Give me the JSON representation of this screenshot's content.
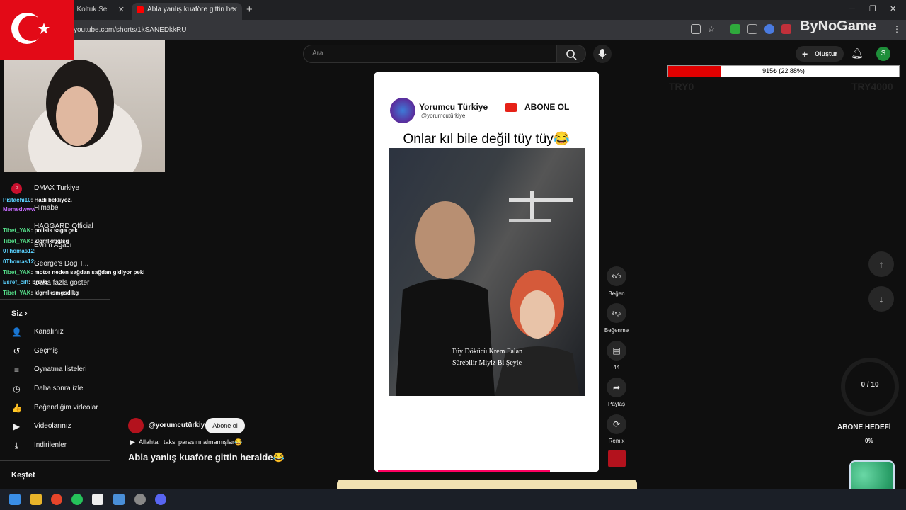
{
  "browser": {
    "tabs": [
      {
        "label": "itası | Koltuk Se",
        "active": false
      },
      {
        "label": "Abla yanlış kuaföre gittin he",
        "active": true
      }
    ],
    "url": "youtube.com/shorts/1kSANEDkkRU",
    "new_tab": "+",
    "minimize": "─",
    "restore": "❐",
    "close": "✕"
  },
  "search": {
    "placeholder": "Ara"
  },
  "header": {
    "create_label": "Oluştur",
    "avatar_letter": "S"
  },
  "sidebar": {
    "subscriptions": [
      {
        "label": "DMAX Turkiye"
      },
      {
        "label": "Himabe"
      },
      {
        "label": "HAGGARD Official"
      },
      {
        "label": "Evrim Ağacı"
      },
      {
        "label": "George's Dog T..."
      },
      {
        "label": "Daha fazla göster"
      }
    ],
    "you_header": "Siz",
    "you_items": [
      {
        "label": "Kanalınız",
        "icon": "channel-icon"
      },
      {
        "label": "Geçmiş",
        "icon": "history-icon"
      },
      {
        "label": "Oynatma listeleri",
        "icon": "playlist-icon"
      },
      {
        "label": "Daha sonra izle",
        "icon": "clock-icon"
      },
      {
        "label": "Beğendiğim videolar",
        "icon": "thumbs-up-icon"
      },
      {
        "label": "Videolarınız",
        "icon": "video-icon"
      },
      {
        "label": "İndirilenler",
        "icon": "download-icon"
      }
    ],
    "explore_header": "Keşfet"
  },
  "chat": [
    {
      "user": "Pistachi10",
      "msg": ": Hadi bekliyoz."
    },
    {
      "user": "Memedwww",
      "msg": ""
    },
    {
      "user": "Tibet_YAK",
      "msg": ": polisis saga çek"
    },
    {
      "user": "Tibet_YAK",
      "msg": ": klgmlkmglsg"
    },
    {
      "user": "0Thomas12",
      "msg": ":"
    },
    {
      "user": "0Thomas12",
      "msg": ":"
    },
    {
      "user": "Tibet_YAK",
      "msg": ": motor neden sağdan sağdan gidiyor peki"
    },
    {
      "user": "Esref_cift",
      "msg": ": bravo"
    },
    {
      "user": "Tibet_YAK",
      "msg": ": klgmlksmgsdlkg"
    }
  ],
  "short": {
    "channel_name": "Yorumcu Türkiye",
    "channel_handle": "@yorumcutürkiye",
    "abone_label": "ABONE OL",
    "caption": "Onlar kıl bile değil tüy tüy😂",
    "subtitle_line1": "Tüy Dökücü Krem Falan",
    "subtitle_line2": "Sürebilir Miyiz Bi Şeyle"
  },
  "actions": {
    "like": "Beğen",
    "dislike": "Beğenme",
    "comments_count": "44",
    "share": "Paylaş",
    "remix": "Remix"
  },
  "info": {
    "creator_handle": "@yorumcutürkiye",
    "subscribe_label": "Abone ol",
    "play_line": "Allahtan taksi parasını almamışlar😂",
    "title": "Abla yanlış kuaföre gittin heralde😂"
  },
  "overlay": {
    "donate_text": "915₺ (22.88%)",
    "donate_progress": 0.2288,
    "try_min": "TRY0",
    "try_max": "TRY4000",
    "counter": "0 / 10",
    "goal_label": "ABONE HEDEFİ",
    "goal_pct": "0%",
    "brand": "ByNoGame"
  },
  "colors": {
    "accent": "#ff0000",
    "background": "#0f0f0f"
  }
}
